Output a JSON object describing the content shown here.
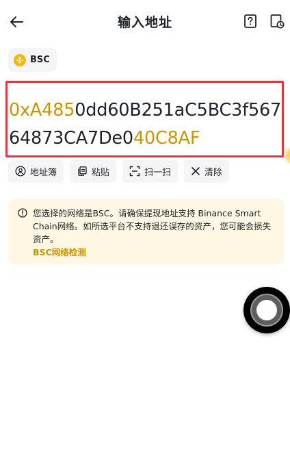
{
  "header": {
    "title": "输入地址",
    "back_icon": "arrow-left-icon",
    "help_icon": "question-icon",
    "history_icon": "history-icon"
  },
  "network": {
    "label": "BSC",
    "icon": "bsc-logo-icon",
    "color": "#F0B90B"
  },
  "address": {
    "prefix": "0xA485",
    "middle": "0dd60B251aC5BC3f56764873CA7De0",
    "suffix": "40C8AF",
    "highlight_color": "#C99400",
    "border_color": "#E0383E"
  },
  "actions": [
    {
      "label": "地址簿",
      "icon": "person-circle-icon"
    },
    {
      "label": "粘贴",
      "icon": "paste-icon"
    },
    {
      "label": "扫一扫",
      "icon": "scan-icon"
    },
    {
      "label": "清除",
      "icon": "close-icon"
    }
  ],
  "notice": {
    "text": "您选择的网络是BSC。请确保提现地址支持 Binance Smart Chain网络。如所选平台不支持退还误存的资产，您可能会损失资产。",
    "link": "BSC网络检测",
    "icon": "info-circle-icon",
    "background": "#FEF7E4"
  },
  "floating_button": {
    "icon": "assistive-touch-icon"
  }
}
